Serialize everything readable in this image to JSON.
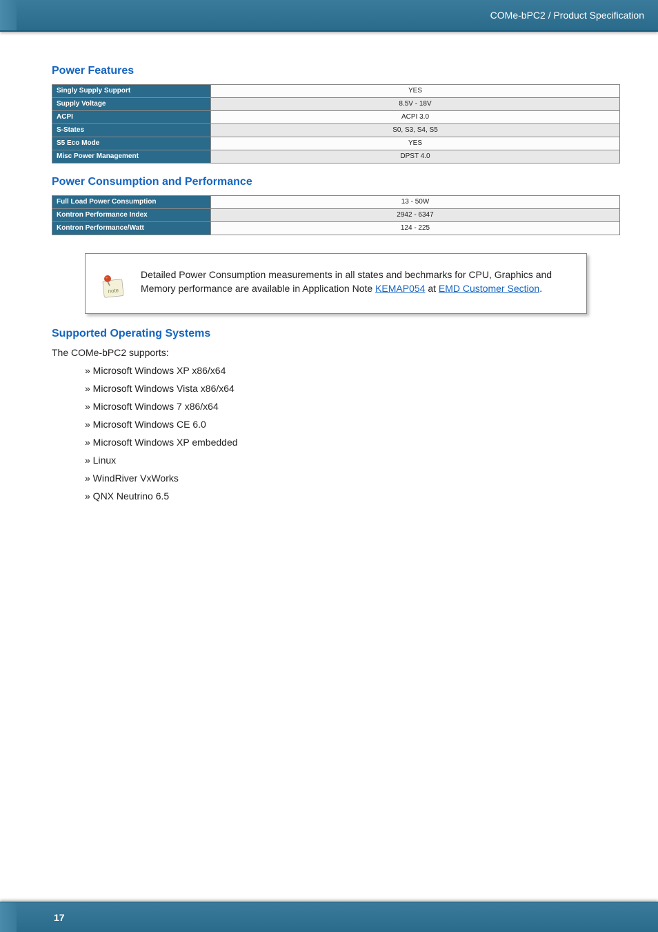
{
  "header": {
    "title": "COMe-bPC2 / Product Specification"
  },
  "sections": {
    "power_features": {
      "heading": "Power Features",
      "rows": [
        {
          "label": "Singly Supply Support",
          "value": "YES"
        },
        {
          "label": "Supply Voltage",
          "value": "8.5V - 18V"
        },
        {
          "label": "ACPI",
          "value": "ACPI 3.0"
        },
        {
          "label": "S-States",
          "value": "S0, S3, S4, S5"
        },
        {
          "label": "S5 Eco Mode",
          "value": "YES"
        },
        {
          "label": "Misc Power Management",
          "value": "DPST 4.0"
        }
      ]
    },
    "power_consumption": {
      "heading": "Power Consumption and Performance",
      "rows": [
        {
          "label": "Full Load Power Consumption",
          "value": "13 - 50W"
        },
        {
          "label": "Kontron Performance Index",
          "value": "2942 - 6347"
        },
        {
          "label": "Kontron Performance/Watt",
          "value": "124 - 225"
        }
      ]
    },
    "note": {
      "text_before": "Detailed Power Consumption measurements in all states and bechmarks for CPU, Graphics and Memory performance are available in Application Note ",
      "link1": "KEMAP054",
      "text_mid": " at ",
      "link2": "EMD Customer Section",
      "text_after": "."
    },
    "os": {
      "heading": "Supported Operating Systems",
      "intro": "The COMe-bPC2 supports:",
      "items": [
        "» Microsoft Windows XP x86/x64",
        "» Microsoft Windows Vista x86/x64",
        "» Microsoft Windows 7 x86/x64",
        "» Microsoft Windows CE 6.0",
        "» Microsoft Windows XP embedded",
        "» Linux",
        "» WindRiver VxWorks",
        "» QNX Neutrino 6.5"
      ]
    }
  },
  "footer": {
    "page": "17"
  }
}
